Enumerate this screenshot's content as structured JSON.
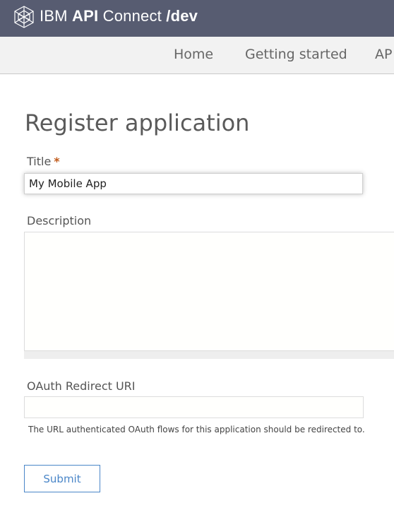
{
  "header": {
    "brand_prefix": "IBM",
    "brand_bold": "API",
    "brand_suffix": "Connect",
    "brand_path": "/dev",
    "logo_icon": "ibm-globe-icon",
    "background": "#575c71"
  },
  "nav": {
    "items": [
      {
        "label": "Home"
      },
      {
        "label": "Getting started"
      },
      {
        "label": "AP"
      }
    ]
  },
  "form": {
    "page_title": "Register application",
    "title_label": "Title",
    "required_marker": "*",
    "title_value": "My Mobile App",
    "description_label": "Description",
    "description_value": "",
    "oauth_label": "OAuth Redirect URI",
    "oauth_value": "",
    "oauth_help": "The URL authenticated OAuth flows for this application should be redirected to.",
    "submit_label": "Submit",
    "accent_color": "#4a86c8",
    "required_color": "#c05a1a"
  }
}
